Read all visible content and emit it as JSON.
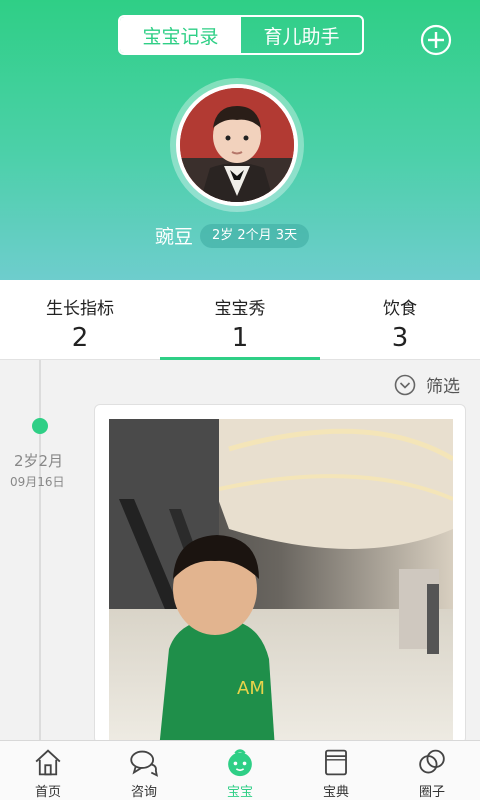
{
  "header": {
    "segment_tabs": [
      {
        "label": "宝宝记录",
        "active": true
      },
      {
        "label": "育儿助手",
        "active": false
      }
    ],
    "add_icon": "plus-circle-icon"
  },
  "profile": {
    "name": "豌豆",
    "age": "2岁 2个月 3天"
  },
  "stats": [
    {
      "label": "生长指标",
      "value": "2"
    },
    {
      "label": "宝宝秀",
      "value": "1",
      "active": true
    },
    {
      "label": "饮食",
      "value": "3"
    }
  ],
  "filter": {
    "label": "筛选",
    "icon": "chevron-down-circle-icon"
  },
  "timeline": [
    {
      "age": "2岁2月",
      "date": "09月16日"
    }
  ],
  "tabbar": [
    {
      "label": "首页",
      "icon": "home-icon"
    },
    {
      "label": "咨询",
      "icon": "chat-icon"
    },
    {
      "label": "宝宝",
      "icon": "baby-icon",
      "active": true
    },
    {
      "label": "宝典",
      "icon": "book-icon"
    },
    {
      "label": "圈子",
      "icon": "circles-icon"
    }
  ],
  "colors": {
    "accent": "#2fcf86",
    "header_bottom": "#6ecdcd"
  }
}
